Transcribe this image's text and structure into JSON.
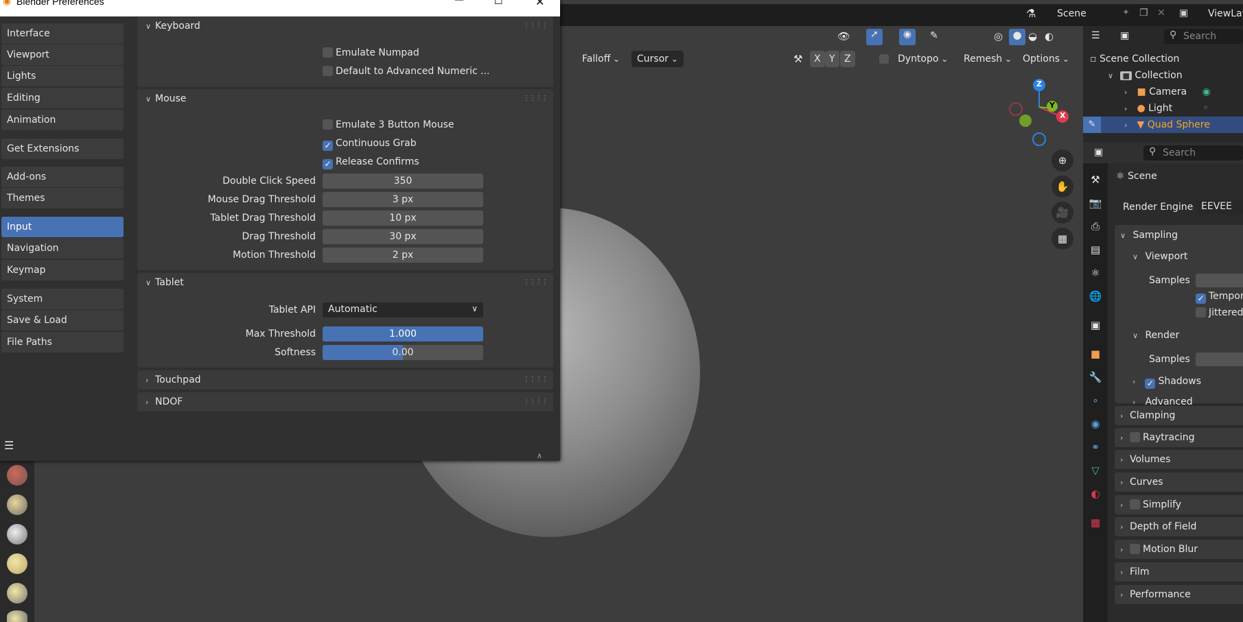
{
  "prefs": {
    "title": "Blender Preferences",
    "nav": [
      "Interface",
      "Viewport",
      "Lights",
      "Editing",
      "Animation",
      "Get Extensions",
      "Add-ons",
      "Themes",
      "Input",
      "Navigation",
      "Keymap",
      "System",
      "Save & Load",
      "File Paths"
    ],
    "active_nav": "Input",
    "keyboard": {
      "heading": "Keyboard",
      "emulate_numpad": "Emulate Numpad",
      "default_adv_numeric": "Default to Advanced Numeric ..."
    },
    "mouse": {
      "heading": "Mouse",
      "emulate_3_button": "Emulate 3 Button Mouse",
      "continuous_grab": "Continuous Grab",
      "release_confirms": "Release Confirms",
      "double_click_label": "Double Click Speed",
      "double_click_value": "350",
      "mouse_drag_label": "Mouse Drag Threshold",
      "mouse_drag_value": "3 px",
      "tablet_drag_label": "Tablet Drag Threshold",
      "tablet_drag_value": "10 px",
      "drag_label": "Drag Threshold",
      "drag_value": "30 px",
      "motion_label": "Motion Threshold",
      "motion_value": "2 px"
    },
    "tablet": {
      "heading": "Tablet",
      "api_label": "Tablet API",
      "api_value": "Automatic",
      "max_threshold_label": "Max Threshold",
      "max_threshold_value": "1.000",
      "softness_label": "Softness",
      "softness_value": "0.00"
    },
    "touchpad": "Touchpad",
    "ndof": "NDOF"
  },
  "topbar": {
    "scene": "Scene",
    "viewlayer": "ViewLay"
  },
  "toolbar": {
    "falloff": "Falloff",
    "cursor": "Cursor",
    "x": "X",
    "y": "Y",
    "z": "Z",
    "dyntopo": "Dyntopo",
    "remesh": "Remesh",
    "options": "Options"
  },
  "outliner": {
    "search": "Search",
    "items": [
      "Scene Collection",
      "Collection",
      "Camera",
      "Light",
      "Quad Sphere"
    ]
  },
  "properties": {
    "search": "Search",
    "scene": "Scene",
    "render_engine_label": "Render Engine",
    "render_engine_value": "EEVEE",
    "sampling": "Sampling",
    "viewport": "Viewport",
    "samples": "Samples",
    "temporal": "Tempor",
    "jittered": "Jittered",
    "render": "Render",
    "render_samples": "Samples",
    "shadows": "Shadows",
    "advanced": "Advanced",
    "sections": [
      "Clamping",
      "Raytracing",
      "Volumes",
      "Curves",
      "Simplify",
      "Depth of Field",
      "Motion Blur",
      "Film",
      "Performance"
    ]
  },
  "gizmo": {
    "x": "X",
    "y": "Y",
    "z": "Z"
  },
  "colors": {
    "accent": "#4772b3",
    "panel": "#3a3a3a",
    "field": "#545454",
    "highlight": "#f5a623"
  }
}
